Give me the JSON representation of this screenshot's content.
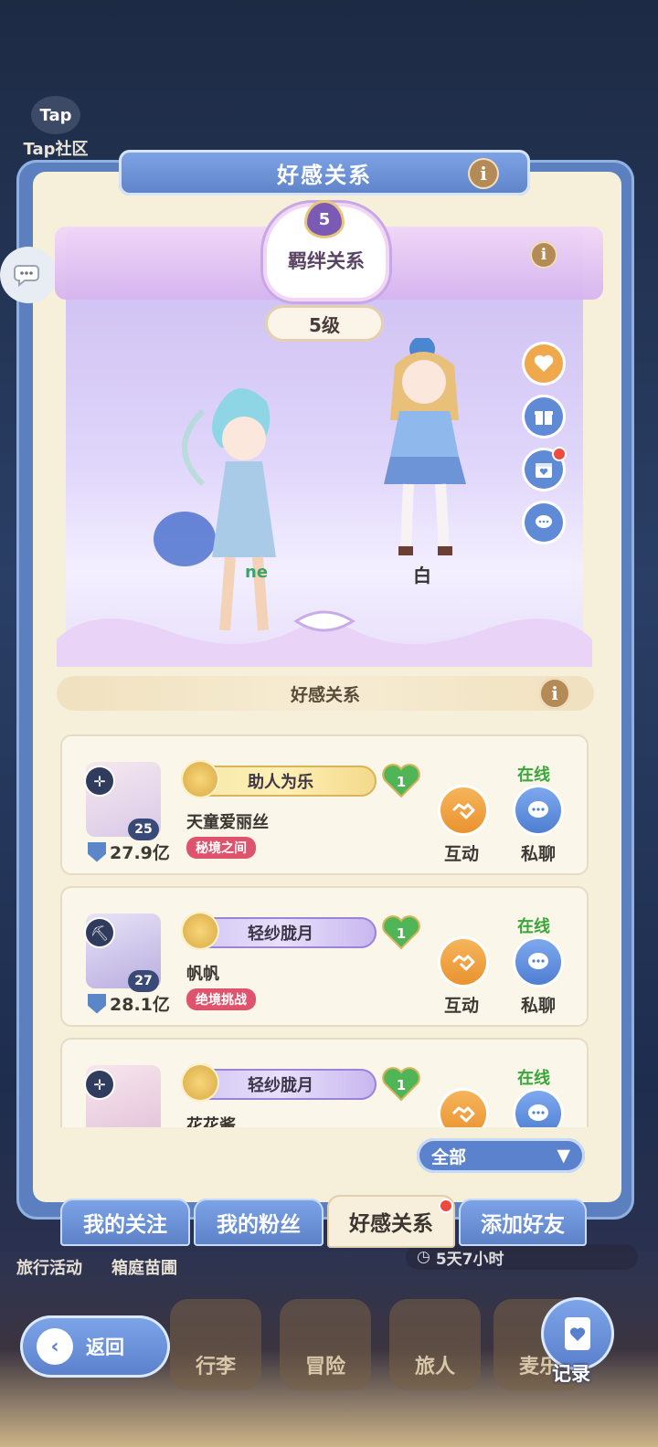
{
  "background": {
    "tap_label": "Tap社区",
    "tap_icon_text": "Tap",
    "under_left_1": "旅行活动",
    "under_left_2": "箱庭苗圃",
    "timer": "5天7小时",
    "nav": [
      "行李",
      "冒险",
      "旅人",
      "麦乐"
    ]
  },
  "panel": {
    "title": "好感关系",
    "info_symbol": "i"
  },
  "bond": {
    "level_badge": "5",
    "label": "羁绊关系",
    "level_text": "5级",
    "char_right_name": "白",
    "char_left_name": "ne"
  },
  "section": {
    "title": "好感关系"
  },
  "friends": [
    {
      "level": "25",
      "power": "27.9亿",
      "title": "助人为乐",
      "plate": "gold",
      "heart": "1",
      "name": "天童爱丽丝",
      "tag": "秘境之间",
      "status": "在线",
      "interact": "互动",
      "chat": "私聊"
    },
    {
      "level": "27",
      "power": "28.1亿",
      "title": "轻纱胧月",
      "plate": "purple",
      "heart": "1",
      "name": "帆帆",
      "tag": "绝境挑战",
      "status": "在线",
      "interact": "互动",
      "chat": "私聊"
    },
    {
      "level": "",
      "power": "",
      "title": "轻纱胧月",
      "plate": "purple",
      "heart": "1",
      "name": "花花酱",
      "tag": "",
      "status": "在线",
      "interact": "",
      "chat": ""
    }
  ],
  "filter": {
    "label": "全部",
    "arrow": "▼"
  },
  "tabs": [
    "我的关注",
    "我的粉丝",
    "好感关系",
    "添加好友"
  ],
  "footer": {
    "back": "返回",
    "record": "记录"
  },
  "colors": {
    "panel_blue": "#5b7fbf",
    "panel_cream": "#f6efda",
    "online_green": "#3aa53a",
    "tag_red": "#e0536c",
    "action_orange": "#ea9330",
    "action_blue": "#4f7fd2"
  }
}
